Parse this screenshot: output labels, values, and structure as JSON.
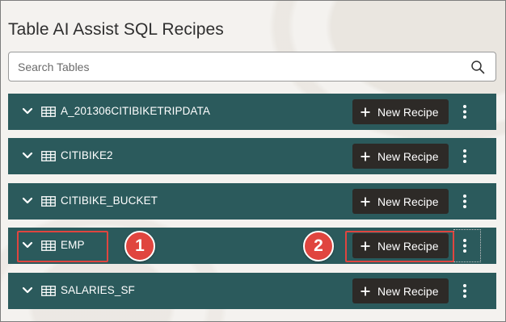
{
  "page": {
    "title": "Table AI Assist SQL Recipes"
  },
  "search": {
    "placeholder": "Search Tables",
    "value": ""
  },
  "rows": [
    {
      "name": "A_201306CITIBIKETRIPDATA",
      "button_label": "New Recipe"
    },
    {
      "name": "CITIBIKE2",
      "button_label": "New Recipe"
    },
    {
      "name": "CITIBIKE_BUCKET",
      "button_label": "New Recipe"
    },
    {
      "name": "EMP",
      "button_label": "New Recipe"
    },
    {
      "name": "SALARIES_SF",
      "button_label": "New Recipe"
    }
  ],
  "annotations": {
    "callout_1": "1",
    "callout_2": "2",
    "color": "#e0453f"
  },
  "colors": {
    "row_background": "#2b5a5c",
    "button_background": "#2d2a27",
    "page_background": "#f4f2ef"
  },
  "icons": {
    "search": "search-icon",
    "expand": "chevron-down-icon",
    "table": "table-grid-icon",
    "add": "plus-icon",
    "more": "kebab-menu-icon"
  }
}
